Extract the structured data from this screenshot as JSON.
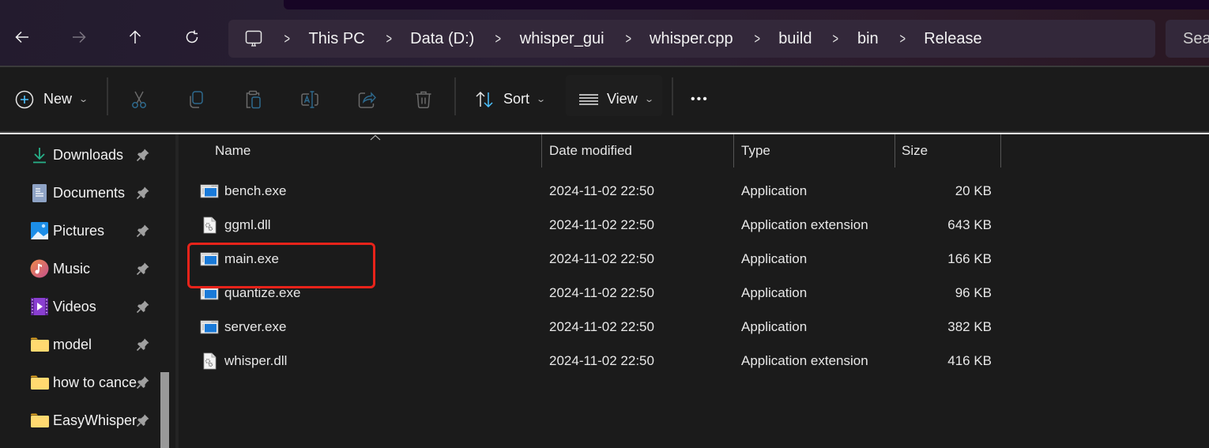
{
  "nav": {
    "back_icon": "arrow-left-icon",
    "forward_icon": "arrow-right-icon",
    "up_icon": "arrow-up-icon",
    "refresh_icon": "refresh-icon"
  },
  "address_bar": {
    "home_icon": "monitor-icon",
    "separator": ">",
    "crumbs": [
      "This PC",
      "Data (D:)",
      "whisper_gui",
      "whisper.cpp",
      "build",
      "bin",
      "Release"
    ]
  },
  "search": {
    "placeholder": "Sea"
  },
  "toolbar": {
    "new_label": "New",
    "sort_label": "Sort",
    "view_label": "View",
    "more_label": "•••",
    "icons": [
      "cut-icon",
      "copy-icon",
      "paste-icon",
      "rename-icon",
      "share-icon",
      "delete-icon"
    ]
  },
  "sidebar": {
    "items": [
      {
        "label": "Downloads",
        "icon": "download-icon",
        "pinned": true
      },
      {
        "label": "Documents",
        "icon": "documents-icon",
        "pinned": true
      },
      {
        "label": "Pictures",
        "icon": "pictures-icon",
        "pinned": true
      },
      {
        "label": "Music",
        "icon": "music-icon",
        "pinned": true
      },
      {
        "label": "Videos",
        "icon": "videos-icon",
        "pinned": true
      },
      {
        "label": "model",
        "icon": "folder-icon",
        "pinned": true
      },
      {
        "label": "how to cance",
        "icon": "folder-icon",
        "pinned": true
      },
      {
        "label": "EasyWhisper",
        "icon": "folder-icon",
        "pinned": true
      }
    ]
  },
  "file_list": {
    "columns": {
      "name": "Name",
      "date": "Date modified",
      "type": "Type",
      "size": "Size"
    },
    "sorted_by": "Name",
    "sort_direction": "ascending",
    "rows": [
      {
        "name": "bench.exe",
        "date": "2024-11-02 22:50",
        "type": "Application",
        "size": "20 KB",
        "kind": "exe"
      },
      {
        "name": "ggml.dll",
        "date": "2024-11-02 22:50",
        "type": "Application extension",
        "size": "643 KB",
        "kind": "dll"
      },
      {
        "name": "main.exe",
        "date": "2024-11-02 22:50",
        "type": "Application",
        "size": "166 KB",
        "kind": "exe",
        "highlighted": true
      },
      {
        "name": "quantize.exe",
        "date": "2024-11-02 22:50",
        "type": "Application",
        "size": "96 KB",
        "kind": "exe"
      },
      {
        "name": "server.exe",
        "date": "2024-11-02 22:50",
        "type": "Application",
        "size": "382 KB",
        "kind": "exe"
      },
      {
        "name": "whisper.dll",
        "date": "2024-11-02 22:50",
        "type": "Application extension",
        "size": "416 KB",
        "kind": "dll"
      }
    ]
  },
  "colors": {
    "accent": "#4cc2ff",
    "highlight_box": "#e8231a",
    "titlebar": "#2a1f34",
    "background": "#1b1b1b"
  }
}
